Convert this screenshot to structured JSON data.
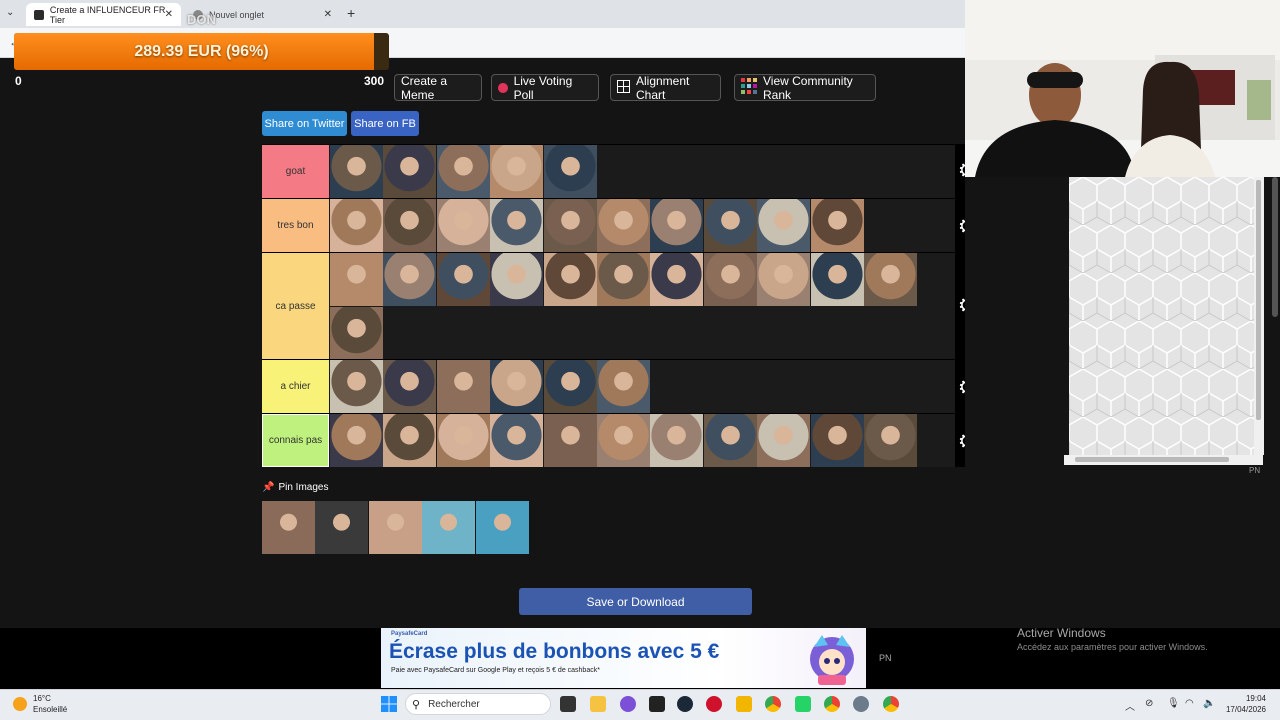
{
  "browser": {
    "tabs": [
      {
        "label": "Create a INFLUENCEUR FR Tier",
        "active": true
      },
      {
        "label": "Nouvel onglet",
        "active": false
      }
    ],
    "overlay_label": "DON"
  },
  "donation": {
    "text": "289.39 EUR (96%)",
    "min": "0",
    "max": "300",
    "progress": 0.96
  },
  "toolbar": {
    "meme": "Create a Meme",
    "poll": "Live Voting Poll",
    "alignment": "Alignment Chart",
    "community": "View Community Rank"
  },
  "share": {
    "twitter": "Share on Twitter",
    "fb": "Share on FB"
  },
  "tiers": [
    {
      "label": "goat",
      "color": "#f47a86",
      "count": 5
    },
    {
      "label": "tres bon",
      "color": "#f9bd82",
      "count": 10
    },
    {
      "label": "ca passe",
      "color": "#fad77e",
      "count": 12
    },
    {
      "label": "a chier",
      "color": "#f8f279",
      "count": 6
    },
    {
      "label": "connais pas",
      "color": "#bff17e",
      "count": 11
    }
  ],
  "pin": {
    "label": "Pin Images",
    "count": 5
  },
  "save_label": "Save or Download",
  "ad": {
    "brand": "PaysafeCard",
    "headline": "Écrase plus de bonbons avec 5 €",
    "sub": "Paie avec PaysafeCard sur Google Play et reçois 5 € de cashback*"
  },
  "pn_label": "PN",
  "windows_activation": {
    "title": "Activer Windows",
    "subtitle": "Accédez aux paramètres pour activer Windows."
  },
  "taskbar": {
    "temperature": "16°C",
    "weather": "Ensoleillé",
    "search_placeholder": "Rechercher",
    "time": "19:04",
    "date": "17/04/2026"
  },
  "colors": {
    "accent_orange": "#ff8f1e",
    "twitter_blue": "#2f8cd3",
    "save_blue": "#3f5ea6"
  }
}
